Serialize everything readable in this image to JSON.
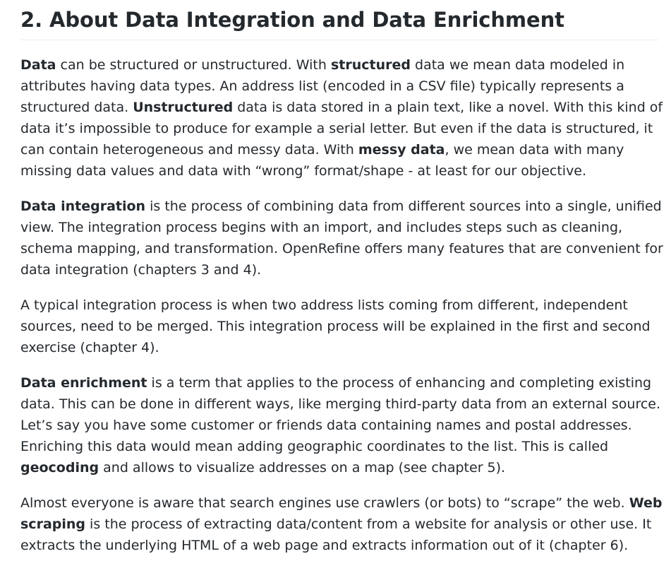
{
  "heading": "2. About Data Integration and Data Enrichment",
  "paragraphs": [
    [
      {
        "t": "Data",
        "b": true
      },
      {
        "t": " can be structured or unstructured. With "
      },
      {
        "t": "structured",
        "b": true
      },
      {
        "t": " data we mean data modeled in attributes having data types. An address list (encoded in a CSV file) typically represents a structured data. "
      },
      {
        "t": "Unstructured",
        "b": true
      },
      {
        "t": " data is data stored in a plain text, like a novel. With this kind of data it’s impossible to produce for example a serial letter. But even if the data is structured, it can contain heterogeneous and messy data. With "
      },
      {
        "t": "messy data",
        "b": true
      },
      {
        "t": ", we mean data with many missing data values and data with “wrong” format/shape - at least for our objective."
      }
    ],
    [
      {
        "t": "Data integration",
        "b": true
      },
      {
        "t": " is the process of combining data from different sources into a single, unified view. The integration process begins with an import, and includes steps such as cleaning, schema mapping, and transformation. OpenRefine offers many features that are convenient for data integration (chapters 3 and 4)."
      }
    ],
    [
      {
        "t": "A typical integration process is when two address lists coming from different, independent sources, need to be merged. This integration process will be explained in the first and second exercise (chapter 4)."
      }
    ],
    [
      {
        "t": "Data enrichment",
        "b": true
      },
      {
        "t": " is a term that applies to the process of enhancing and completing existing data. This can be done in different ways, like merging third-party data from an external source. Let’s say you have some customer or friends data containing names and postal addresses. Enriching this data would mean adding geographic coordinates to the list. This is called "
      },
      {
        "t": "geocoding",
        "b": true
      },
      {
        "t": " and allows to visualize addresses on a map (see chapter 5)."
      }
    ],
    [
      {
        "t": "Almost everyone is aware that search engines use crawlers (or bots) to “scrape” the web. "
      },
      {
        "t": "Web scraping",
        "b": true
      },
      {
        "t": " is the process of extracting data/content from a website for analysis or other use. It extracts the underlying HTML of a web page and extracts information out of it (chapter 6)."
      }
    ]
  ]
}
